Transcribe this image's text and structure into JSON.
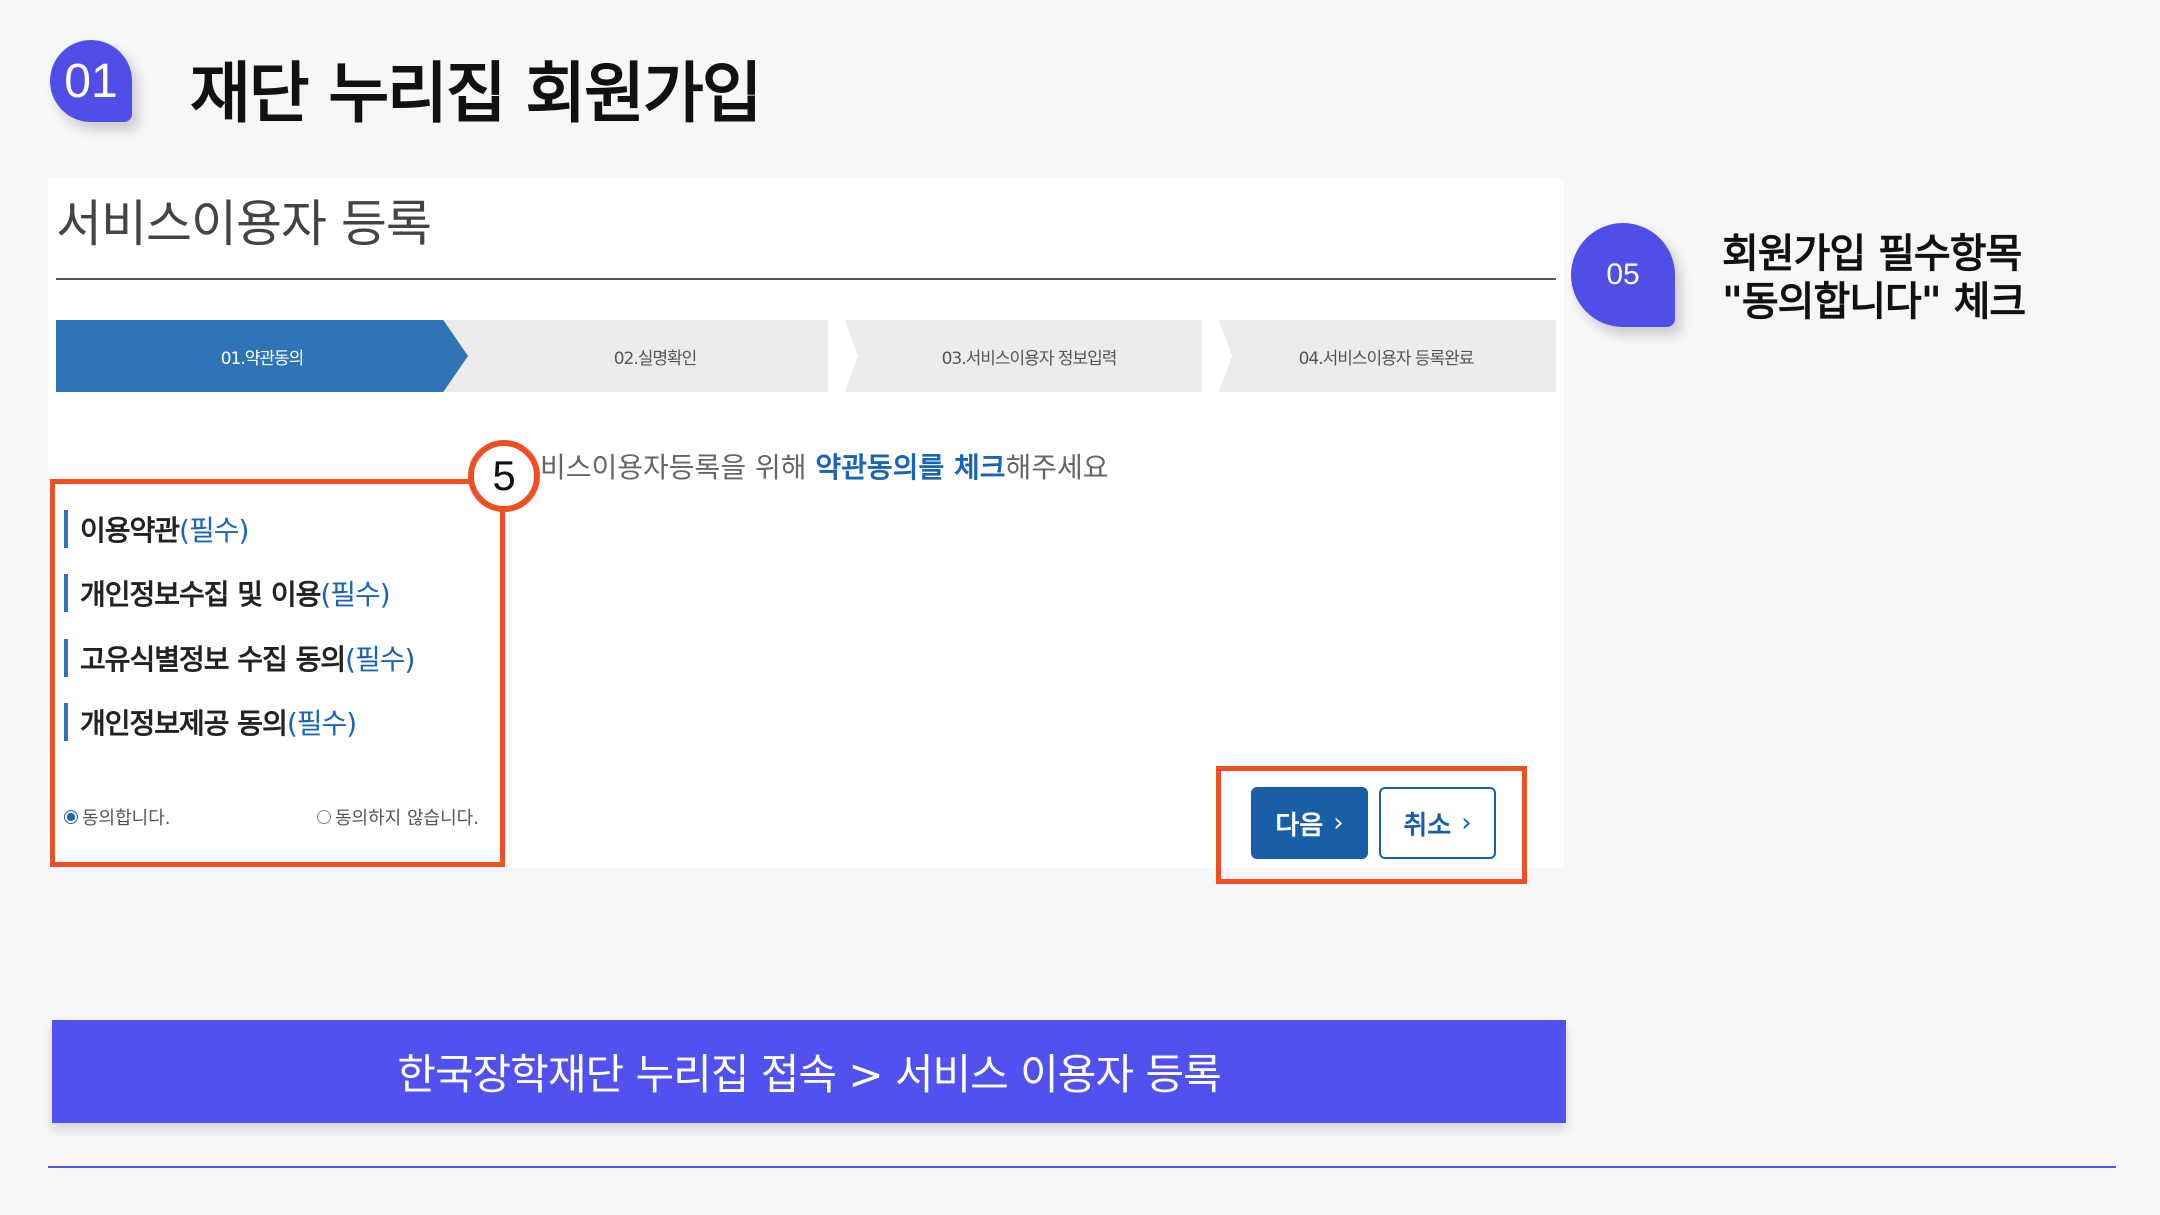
{
  "header": {
    "badge": "01",
    "title": "재단 누리집 회원가입"
  },
  "form": {
    "section_title": "서비스이용자 등록",
    "steps": [
      {
        "label": "01.약관동의",
        "active": true
      },
      {
        "label": "02.실명확인",
        "active": false
      },
      {
        "label": "03.서비스이용자 정보입력",
        "active": false
      },
      {
        "label": "04.서비스이용자 등록완료",
        "active": false
      }
    ],
    "instruction": {
      "prefix": "비스이용자등록을 위해 ",
      "highlight": "약관동의를 체크",
      "suffix": "해주세요"
    },
    "terms": [
      {
        "label": "이용약관",
        "required": "(필수)"
      },
      {
        "label": "개인정보수집 및 이용",
        "required": "(필수)"
      },
      {
        "label": "고유식별정보 수집 동의",
        "required": "(필수)"
      },
      {
        "label": "개인정보제공 동의",
        "required": "(필수)"
      }
    ],
    "agree_label": "동의합니다.",
    "disagree_label": "동의하지 않습니다.",
    "agree_selected": true,
    "next_label": "다음",
    "cancel_label": "취소"
  },
  "step_marker": "5",
  "callout": {
    "badge": "05",
    "line1": "회원가입 필수항목",
    "line2": "\"동의합니다\" 체크"
  },
  "bottom_bar": "한국장학재단 누리집 접속 > 서비스 이용자 등록",
  "colors": {
    "accent": "#5151ef",
    "highlight_box": "#f04e23",
    "active_step": "#2d73b6",
    "button": "#1b5ea8"
  }
}
